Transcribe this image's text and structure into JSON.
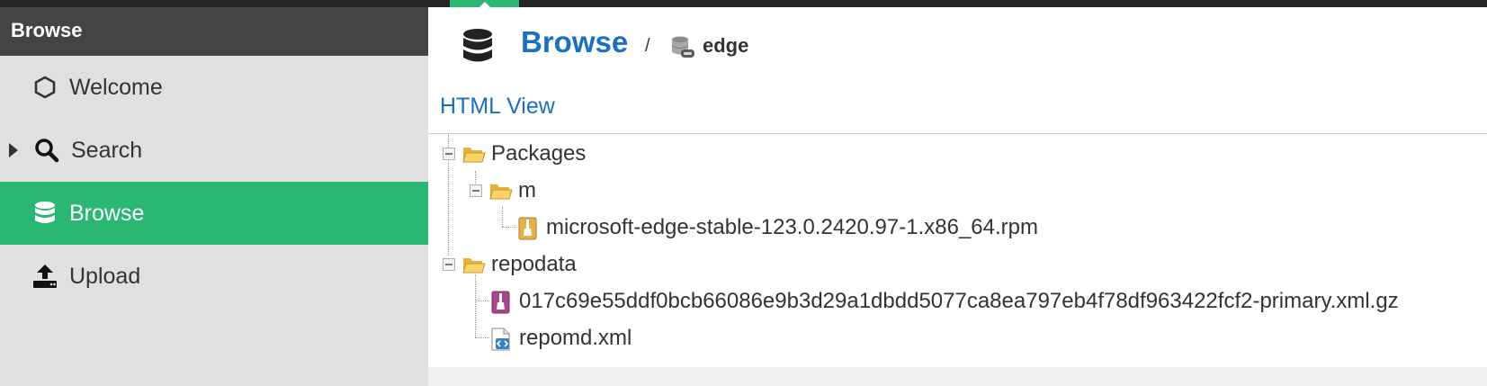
{
  "sidebar": {
    "header": "Browse",
    "items": [
      {
        "label": "Welcome",
        "icon": "hexagon-icon"
      },
      {
        "label": "Search",
        "icon": "search-icon"
      },
      {
        "label": "Browse",
        "icon": "database-icon"
      },
      {
        "label": "Upload",
        "icon": "upload-icon"
      }
    ]
  },
  "main": {
    "title": "Browse",
    "separator": "/",
    "repository": "edge",
    "view_link": "HTML View"
  },
  "tree": [
    {
      "label": "Packages",
      "type": "folder-open"
    },
    {
      "label": "m",
      "type": "folder-open"
    },
    {
      "label": "microsoft-edge-stable-123.0.2420.97-1.x86_64.rpm",
      "type": "rpm-file"
    },
    {
      "label": "repodata",
      "type": "folder-open"
    },
    {
      "label": "017c69e55ddf0bcb66086e9b3d29a1dbdd5077ca8ea797eb4f78df963422fcf2-primary.xml.gz",
      "type": "archive-file"
    },
    {
      "label": "repomd.xml",
      "type": "xml-file"
    }
  ],
  "colors": {
    "accent_green": "#2ab673",
    "link_blue": "#1a70c0",
    "sidebar_bg": "#e0e0e0",
    "header_bg": "#444444"
  }
}
